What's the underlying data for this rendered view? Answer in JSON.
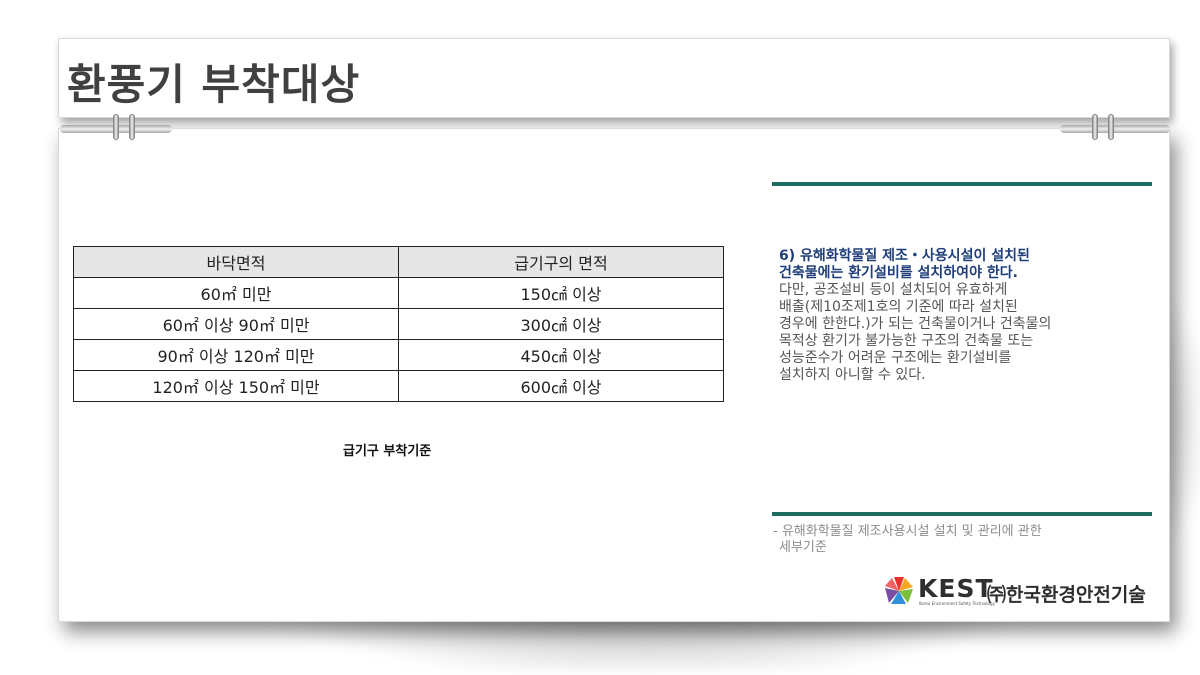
{
  "title": "환풍기 부착대상",
  "table": {
    "headers": [
      "바닥면적",
      "급기구의 면적"
    ],
    "rows": [
      [
        "60㎡ 미만",
        "150㎠ 이상"
      ],
      [
        "60㎡ 이상 90㎡ 미만",
        "300㎠ 이상"
      ],
      [
        "90㎡ 이상 120㎡ 미만",
        "450㎠ 이상"
      ],
      [
        "120㎡ 이상 150㎡ 미만",
        "600㎠ 이상"
      ]
    ],
    "caption": "급기구 부착기준"
  },
  "description": {
    "highlight": [
      "6) 유해화학물질 제조・사용시설이 설치된",
      "건축물에는 환기설비를 설치하여야 한다."
    ],
    "body": [
      "다만, 공조설비 등이 설치되어 유효하게",
      "배출(제10조제1호의 기준에 따라 설치된",
      "경우에 한한다.)가 되는 건축물이거나 건축물의",
      "목적상 환기가 불가능한 구조의 건축물 또는",
      "성능준수가 어려운 구조에는 환기설비를",
      "설치하지 아니할 수 있다."
    ]
  },
  "source": [
    "- 유해화학물질 제조사용시설 설치 및 관리에 관한",
    "세부기준"
  ],
  "logo": {
    "brand": "KEST",
    "subtitle": "Korea Environment Safety Technology",
    "company": "㈜한국환경안전기술",
    "colors": [
      "#e8312f",
      "#f5a623",
      "#7cbf3a",
      "#2f8fd8",
      "#7a4fa0"
    ]
  },
  "colors": {
    "accent_green": "#1e6b60",
    "highlight_blue": "#1f3e7a"
  }
}
